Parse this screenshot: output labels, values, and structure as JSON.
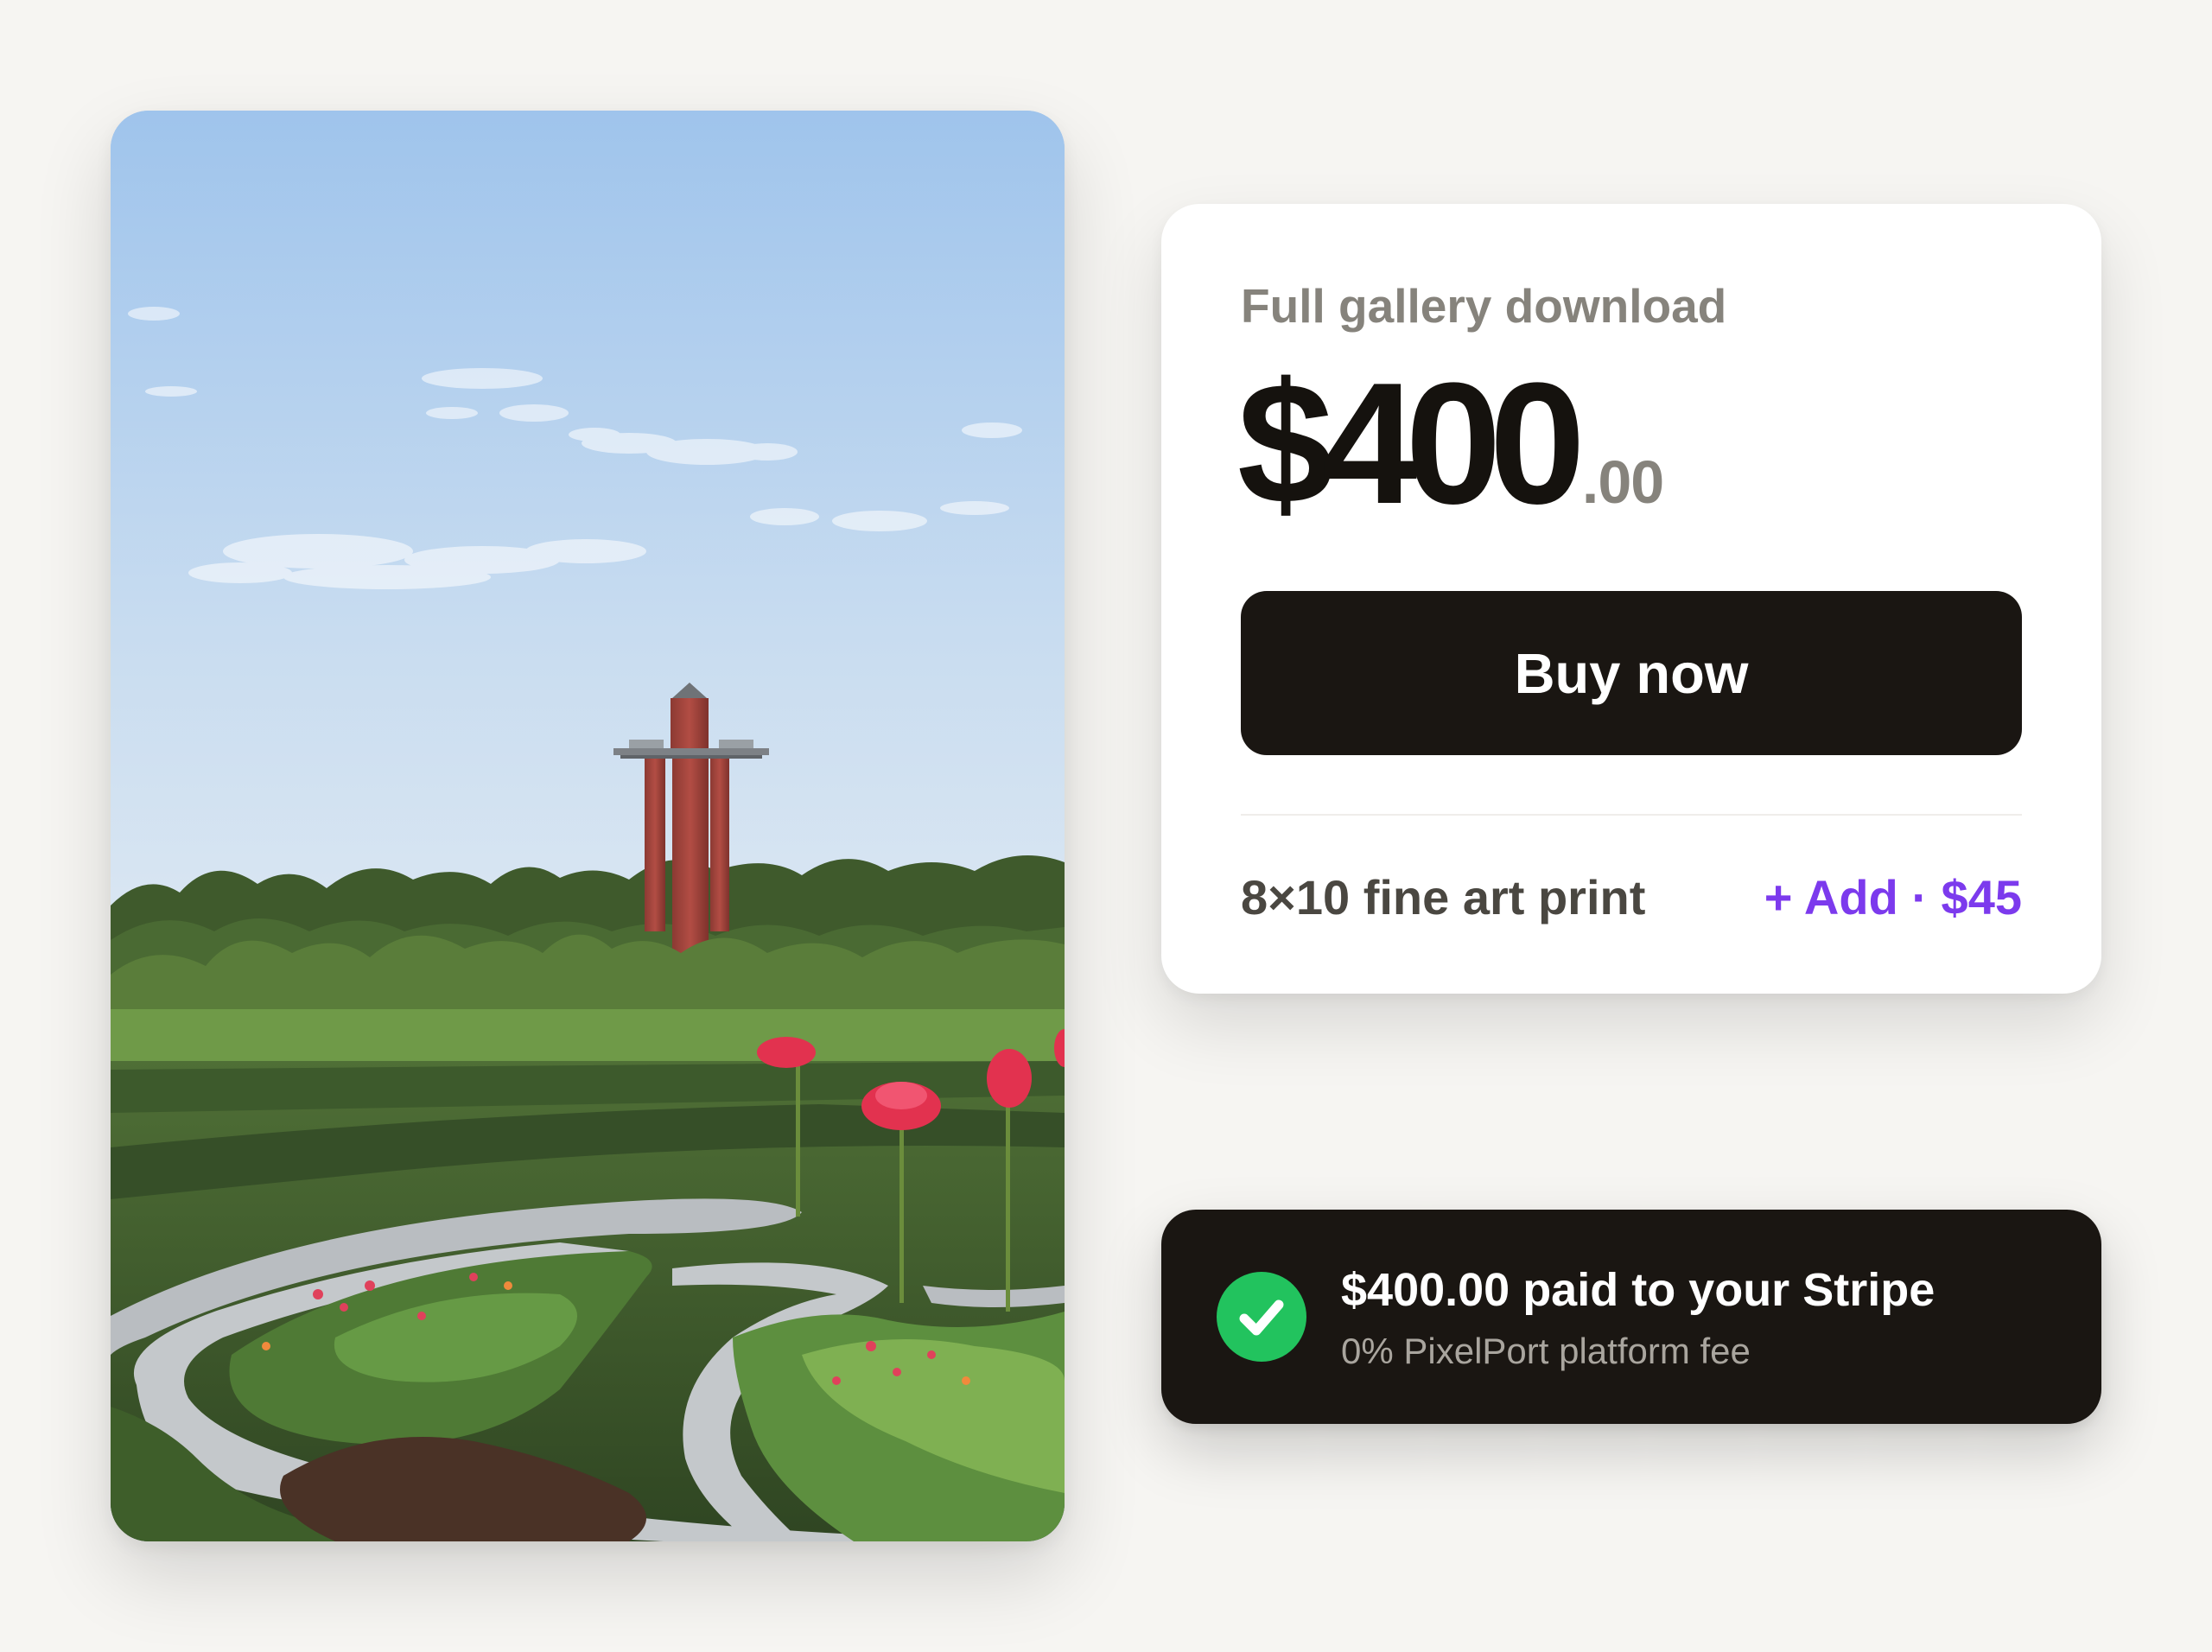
{
  "colors": {
    "background": "#f6f5f2",
    "card": "#ffffff",
    "dark": "#1a1612",
    "muted_text": "#86837c",
    "accent_purple": "#7c3aed",
    "success_green": "#22c35e"
  },
  "photo": {
    "icon": "garden-photo"
  },
  "product": {
    "label": "Full gallery download",
    "price_main": "$400",
    "price_cents": ".00",
    "buy_label": "Buy now",
    "addon": {
      "label": "8×10 fine art print",
      "action_label": "+ Add · $45"
    }
  },
  "payment": {
    "icon": "check-icon",
    "title": "$400.00 paid to your Stripe",
    "subtitle": "0% PixelPort platform fee"
  }
}
